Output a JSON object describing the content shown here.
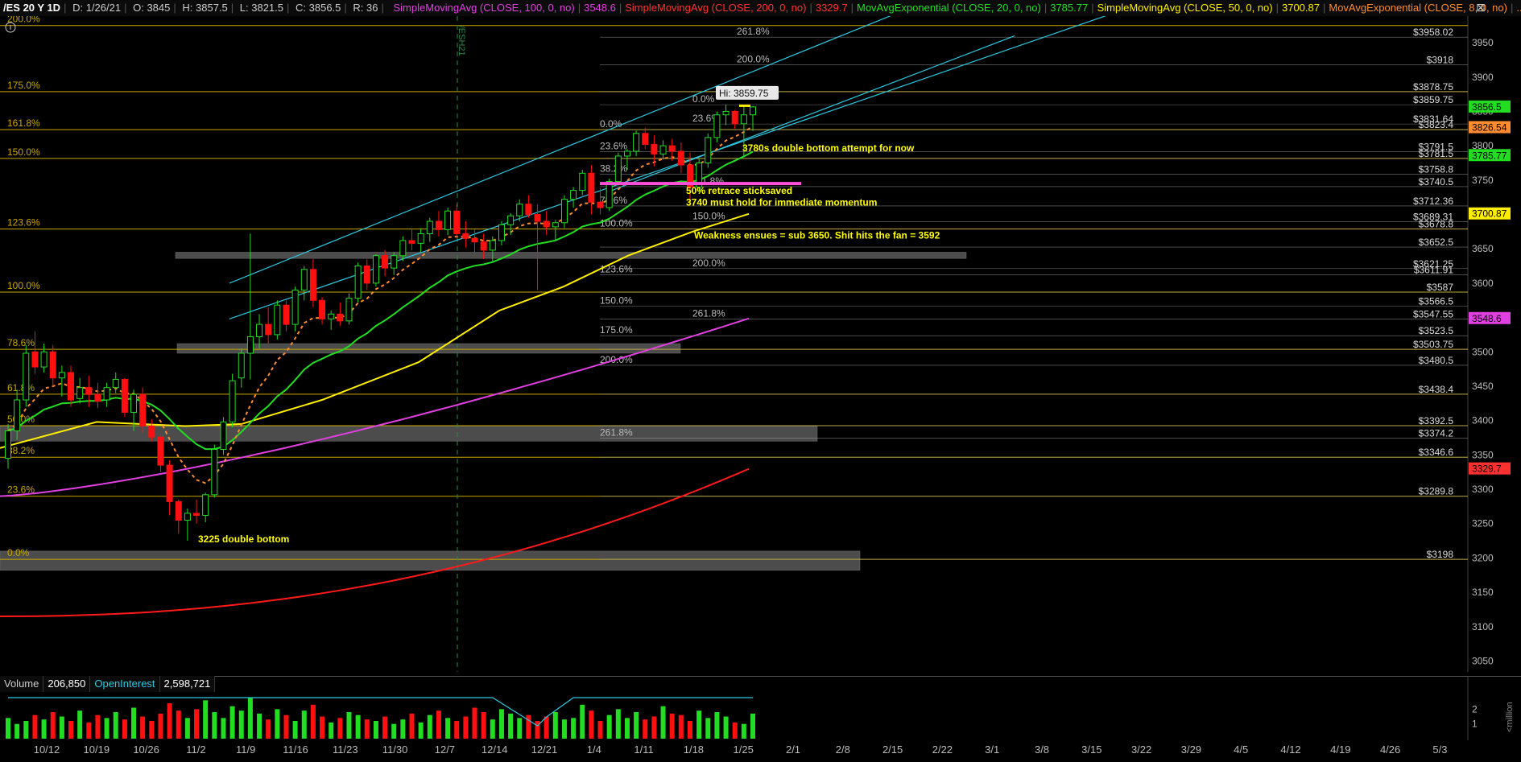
{
  "header": {
    "symbol": "/ES 20 Y 1D",
    "date": "D: 1/26/21",
    "open": "O: 3845",
    "high": "H: 3857.5",
    "low": "L: 3821.5",
    "close": "C: 3856.5",
    "range": "R: 36",
    "studies": [
      {
        "label": "SimpleMovingAvg (CLOSE, 100, 0, no)",
        "value": "3548.6",
        "color": "#e040e0"
      },
      {
        "label": "SimpleMovingAvg (CLOSE, 200, 0, no)",
        "value": "3329.7",
        "color": "#ff3030"
      },
      {
        "label": "MovAvgExponential (CLOSE, 20, 0, no)",
        "value": "3785.77",
        "color": "#22dd22"
      },
      {
        "label": "SimpleMovingAvg (CLOSE, 50, 0, no)",
        "value": "3700.87",
        "color": "#ffee00"
      },
      {
        "label": "MovAvgExponential (CLOSE, 8, 0, no)",
        "value": "...",
        "color": "#ff8c30"
      }
    ]
  },
  "colors": {
    "up_candle": "#22dd22",
    "down_candle": "#ff1010",
    "fib_line": "#c8a800",
    "level_line": "#aaaaaa",
    "channel": "#30c8e0",
    "zone": "#8a8a8a",
    "annotation": "#ffff00"
  },
  "chart_data": {
    "type": "candlestick",
    "y_axis_range": [
      3010,
      4020
    ],
    "y_ticks": [
      3050,
      3100,
      3150,
      3200,
      3250,
      3300,
      3350,
      3400,
      3450,
      3500,
      3550,
      3600,
      3650,
      3700,
      3750,
      3800,
      3850,
      3900,
      3950
    ],
    "x_ticks": [
      "10/12",
      "10/19",
      "10/26",
      "11/2",
      "11/9",
      "11/16",
      "11/23",
      "11/30",
      "12/7",
      "12/14",
      "12/21",
      "1/4",
      "1/11",
      "1/18",
      "1/25",
      "2/1",
      "2/8",
      "2/15",
      "2/22",
      "3/1",
      "3/8",
      "3/15",
      "3/22",
      "3/29",
      "4/5",
      "4/12",
      "4/19",
      "4/26",
      "5/3"
    ],
    "price_badges": [
      {
        "value": "3856.5",
        "price": 3856.5,
        "color": "#22dd22"
      },
      {
        "value": "3826.54",
        "price": 3826.5,
        "color": "#ff8c30"
      },
      {
        "value": "3785.77",
        "price": 3785.8,
        "color": "#22dd22"
      },
      {
        "value": "3700.87",
        "price": 3700.9,
        "color": "#ffee00"
      },
      {
        "value": "3548.6",
        "price": 3548.6,
        "color": "#e040e0"
      },
      {
        "value": "3329.7",
        "price": 3329.7,
        "color": "#ff3030"
      }
    ],
    "price_levels": [
      {
        "label": "$3958.02",
        "price": 3958.02
      },
      {
        "label": "$3918",
        "price": 3918
      },
      {
        "label": "$3878.75",
        "price": 3878.75
      },
      {
        "label": "$3859.75",
        "price": 3859.75
      },
      {
        "label": "$3831.64",
        "price": 3831.64
      },
      {
        "label": "$3823.4",
        "price": 3823.4
      },
      {
        "label": "$3791.5",
        "price": 3791.5
      },
      {
        "label": "$3781.5",
        "price": 3781.5
      },
      {
        "label": "$3758.8",
        "price": 3758.8
      },
      {
        "label": "$3740.5",
        "price": 3740.5
      },
      {
        "label": "$3712.36",
        "price": 3712.36
      },
      {
        "label": "$3689.31",
        "price": 3689.31
      },
      {
        "label": "$3678.8",
        "price": 3678.8
      },
      {
        "label": "$3652.5",
        "price": 3652.5
      },
      {
        "label": "$3621.25",
        "price": 3621.25
      },
      {
        "label": "$3611.91",
        "price": 3611.91
      },
      {
        "label": "$3587",
        "price": 3587
      },
      {
        "label": "$3566.5",
        "price": 3566.5
      },
      {
        "label": "$3547.55",
        "price": 3547.55
      },
      {
        "label": "$3523.5",
        "price": 3523.5
      },
      {
        "label": "$3503.75",
        "price": 3503.75
      },
      {
        "label": "$3480.5",
        "price": 3480.5
      },
      {
        "label": "$3438.4",
        "price": 3438.4
      },
      {
        "label": "$3392.5",
        "price": 3392.5
      },
      {
        "label": "$3374.2",
        "price": 3374.2
      },
      {
        "label": "$3346.6",
        "price": 3346.6
      },
      {
        "label": "$3289.8",
        "price": 3289.8
      },
      {
        "label": "$3198",
        "price": 3198
      }
    ],
    "fib_levels_left": [
      {
        "label": "175.0%",
        "price": 3878.75
      },
      {
        "label": "161.8%",
        "price": 3823.4
      },
      {
        "label": "150.0%",
        "price": 3781.5
      },
      {
        "label": "123.6%",
        "price": 3678.8
      },
      {
        "label": "100.0%",
        "price": 3587
      },
      {
        "label": "78.6%",
        "price": 3503.75
      },
      {
        "label": "61.8%",
        "price": 3438.4
      },
      {
        "label": "50.0%",
        "price": 3392.5
      },
      {
        "label": "38.2%",
        "price": 3346.6
      },
      {
        "label": "23.6%",
        "price": 3289.8
      },
      {
        "label": "0.0%",
        "price": 3198
      },
      {
        "label": "200.0%",
        "price": 3975
      }
    ],
    "fib_labels_mid": [
      {
        "label": "261.8%",
        "price": 3958.02,
        "x": 915
      },
      {
        "label": "200.0%",
        "price": 3918,
        "x": 915
      },
      {
        "label": "0.0%",
        "price": 3859.75,
        "x": 860
      },
      {
        "label": "23.6%",
        "price": 3831.64,
        "x": 860
      },
      {
        "label": "0.0%",
        "price": 3823.4,
        "x": 745
      },
      {
        "label": "23.6%",
        "price": 3791.5,
        "x": 745
      },
      {
        "label": "38.2%",
        "price": 3758.8,
        "x": 745
      },
      {
        "label": "61.8%",
        "price": 3740.5,
        "x": 865
      },
      {
        "label": "78.6%",
        "price": 3712.36,
        "x": 745
      },
      {
        "label": "100.0%",
        "price": 3678.8,
        "x": 745
      },
      {
        "label": "150.0%",
        "price": 3689.31,
        "x": 860
      },
      {
        "label": "200.0%",
        "price": 3621.25,
        "x": 860
      },
      {
        "label": "123.6%",
        "price": 3611.91,
        "x": 745
      },
      {
        "label": "150.0%",
        "price": 3566.5,
        "x": 745
      },
      {
        "label": "261.8%",
        "price": 3547.55,
        "x": 860
      },
      {
        "label": "175.0%",
        "price": 3523.5,
        "x": 745
      },
      {
        "label": "200.0%",
        "price": 3480.5,
        "x": 745
      },
      {
        "label": "261.8%",
        "price": 3374.2,
        "x": 745
      }
    ],
    "annotations": [
      {
        "text": "Hi: 3859.75",
        "price": 3873,
        "x": 893
      },
      {
        "text": "3780s double bottom attempt for now",
        "price": 3792,
        "x": 922
      },
      {
        "text": "50% retrace sticksaved",
        "price": 3730,
        "x": 852
      },
      {
        "text": "3740 must hold for immediate momentum",
        "price": 3713,
        "x": 852
      },
      {
        "text": "Weakness ensues = sub 3650. Shit hits the fan = 3592",
        "price": 3665,
        "x": 862
      },
      {
        "text": "3225 double bottom",
        "price": 3223,
        "x": 246
      },
      {
        "text": "/ESH21",
        "price": 3975,
        "x": 570
      }
    ],
    "candles_ohlc": [
      [
        3345,
        3395,
        3330,
        3385
      ],
      [
        3385,
        3445,
        3372,
        3430
      ],
      [
        3430,
        3510,
        3420,
        3498
      ],
      [
        3500,
        3530,
        3468,
        3478
      ],
      [
        3478,
        3512,
        3470,
        3500
      ],
      [
        3500,
        3510,
        3450,
        3462
      ],
      [
        3462,
        3480,
        3435,
        3470
      ],
      [
        3470,
        3480,
        3420,
        3430
      ],
      [
        3432,
        3462,
        3425,
        3448
      ],
      [
        3448,
        3465,
        3420,
        3438
      ],
      [
        3438,
        3455,
        3418,
        3428
      ],
      [
        3430,
        3455,
        3420,
        3448
      ],
      [
        3448,
        3470,
        3440,
        3460
      ],
      [
        3460,
        3462,
        3405,
        3412
      ],
      [
        3412,
        3445,
        3385,
        3438
      ],
      [
        3438,
        3448,
        3382,
        3392
      ],
      [
        3392,
        3402,
        3370,
        3376
      ],
      [
        3376,
        3380,
        3325,
        3335
      ],
      [
        3335,
        3342,
        3262,
        3282
      ],
      [
        3282,
        3285,
        3235,
        3255
      ],
      [
        3255,
        3272,
        3225,
        3265
      ],
      [
        3265,
        3285,
        3250,
        3262
      ],
      [
        3262,
        3295,
        3252,
        3292
      ],
      [
        3292,
        3365,
        3288,
        3358
      ],
      [
        3358,
        3405,
        3350,
        3398
      ],
      [
        3398,
        3468,
        3390,
        3458
      ],
      [
        3462,
        3505,
        3448,
        3498
      ],
      [
        3498,
        3672,
        3460,
        3522
      ],
      [
        3522,
        3555,
        3505,
        3540
      ],
      [
        3540,
        3565,
        3512,
        3525
      ],
      [
        3525,
        3575,
        3518,
        3568
      ],
      [
        3568,
        3575,
        3530,
        3540
      ],
      [
        3540,
        3595,
        3530,
        3590
      ],
      [
        3590,
        3625,
        3575,
        3620
      ],
      [
        3620,
        3635,
        3565,
        3575
      ],
      [
        3575,
        3580,
        3540,
        3548
      ],
      [
        3548,
        3560,
        3532,
        3555
      ],
      [
        3555,
        3572,
        3538,
        3545
      ],
      [
        3545,
        3585,
        3540,
        3578
      ],
      [
        3578,
        3630,
        3572,
        3625
      ],
      [
        3625,
        3635,
        3590,
        3600
      ],
      [
        3600,
        3642,
        3595,
        3640
      ],
      [
        3640,
        3648,
        3610,
        3622
      ],
      [
        3622,
        3645,
        3612,
        3640
      ],
      [
        3640,
        3668,
        3632,
        3662
      ],
      [
        3662,
        3680,
        3648,
        3658
      ],
      [
        3658,
        3680,
        3645,
        3672
      ],
      [
        3672,
        3695,
        3660,
        3690
      ],
      [
        3690,
        3705,
        3668,
        3678
      ],
      [
        3678,
        3710,
        3670,
        3705
      ],
      [
        3705,
        3715,
        3665,
        3672
      ],
      [
        3672,
        3690,
        3652,
        3665
      ],
      [
        3665,
        3678,
        3640,
        3660
      ],
      [
        3660,
        3672,
        3635,
        3648
      ],
      [
        3648,
        3668,
        3632,
        3662
      ],
      [
        3662,
        3690,
        3655,
        3685
      ],
      [
        3685,
        3702,
        3670,
        3698
      ],
      [
        3698,
        3722,
        3690,
        3715
      ],
      [
        3715,
        3728,
        3695,
        3700
      ],
      [
        3700,
        3715,
        3590,
        3690
      ],
      [
        3690,
        3705,
        3670,
        3682
      ],
      [
        3682,
        3692,
        3662,
        3688
      ],
      [
        3688,
        3728,
        3680,
        3722
      ],
      [
        3722,
        3740,
        3710,
        3735
      ],
      [
        3735,
        3765,
        3728,
        3760
      ],
      [
        3760,
        3772,
        3700,
        3718
      ],
      [
        3718,
        3738,
        3700,
        3710
      ],
      [
        3710,
        3752,
        3705,
        3748
      ],
      [
        3748,
        3790,
        3742,
        3785
      ],
      [
        3785,
        3795,
        3765,
        3792
      ],
      [
        3792,
        3822,
        3785,
        3818
      ],
      [
        3818,
        3826,
        3795,
        3802
      ],
      [
        3802,
        3815,
        3770,
        3788
      ],
      [
        3788,
        3808,
        3780,
        3800
      ],
      [
        3800,
        3810,
        3778,
        3792
      ],
      [
        3792,
        3805,
        3760,
        3772
      ],
      [
        3772,
        3790,
        3715,
        3740
      ],
      [
        3740,
        3782,
        3732,
        3775
      ],
      [
        3775,
        3818,
        3768,
        3812
      ],
      [
        3812,
        3850,
        3805,
        3845
      ],
      [
        3845,
        3860,
        3830,
        3850
      ],
      [
        3850,
        3852,
        3825,
        3832
      ],
      [
        3832,
        3858,
        3785,
        3845
      ],
      [
        3845,
        3857.5,
        3821.5,
        3856.5
      ]
    ],
    "volume_unit": "<million",
    "volume_ticks": [
      1,
      2
    ],
    "volume_values": [
      1.4,
      1.0,
      1.2,
      1.6,
      1.3,
      1.8,
      1.5,
      1.2,
      1.9,
      1.1,
      1.6,
      1.4,
      1.8,
      1.3,
      2.1,
      1.5,
      1.2,
      1.7,
      2.4,
      1.9,
      1.4,
      2.0,
      2.6,
      1.8,
      1.4,
      2.2,
      1.9,
      2.8,
      1.7,
      1.3,
      2.0,
      1.6,
      1.2,
      1.9,
      2.3,
      1.5,
      1.1,
      1.4,
      1.8,
      1.6,
      1.3,
      1.2,
      1.5,
      1.0,
      1.3,
      1.7,
      1.1,
      1.6,
      1.9,
      1.4,
      1.2,
      1.5,
      2.1,
      1.8,
      1.3,
      2.0,
      1.7,
      1.4,
      1.6,
      1.2,
      1.5,
      1.8,
      1.3,
      1.4,
      2.3,
      1.9,
      1.2,
      1.6,
      2.0,
      1.4,
      1.8,
      1.3,
      1.5,
      2.2,
      1.7,
      1.6,
      1.2,
      1.9,
      1.4,
      1.8,
      1.5,
      1.1,
      1.0,
      1.7
    ],
    "volume_header": {
      "volume_label": "Volume",
      "volume_value": "206,850",
      "oi_label": "OpenInterest",
      "oi_value": "2,598,721"
    }
  }
}
